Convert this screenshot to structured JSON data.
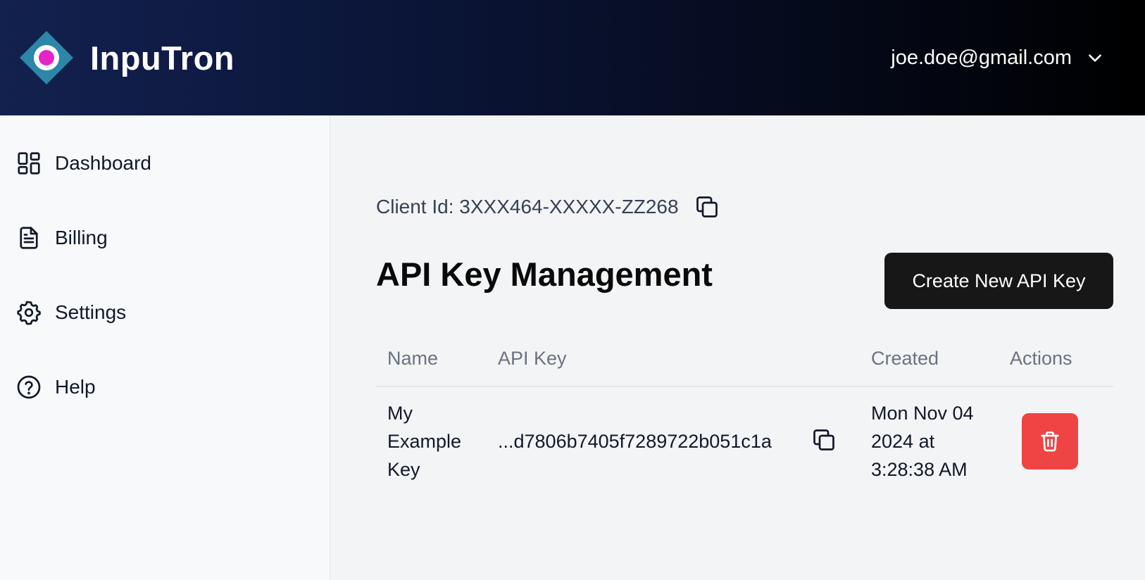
{
  "header": {
    "brand_name": "InpuTron",
    "account_email": "joe.doe@gmail.com"
  },
  "sidebar": {
    "items": [
      {
        "label": "Dashboard",
        "icon": "dashboard-icon"
      },
      {
        "label": "Billing",
        "icon": "document-icon"
      },
      {
        "label": "Settings",
        "icon": "gear-icon"
      },
      {
        "label": "Help",
        "icon": "help-circle-icon"
      }
    ]
  },
  "main": {
    "client_id_text": "Client Id: 3XXX464-XXXXX-ZZ268",
    "title": "API Key Management",
    "create_button_label": "Create New API Key",
    "table": {
      "headers": [
        "Name",
        "API Key",
        "Created",
        "Actions"
      ],
      "rows": [
        {
          "name": "My Example Key",
          "api_key": "...d7806b7405f7289722b051c1a",
          "created": "Mon Nov 04 2024 at 3:28:38 AM"
        }
      ]
    }
  },
  "colors": {
    "header_gradient_start": "#13214f",
    "header_gradient_end": "#000000",
    "primary_button": "#171717",
    "danger_button": "#ef4444",
    "logo_diamond": "#2b86a8",
    "logo_dot": "#e624c6"
  }
}
